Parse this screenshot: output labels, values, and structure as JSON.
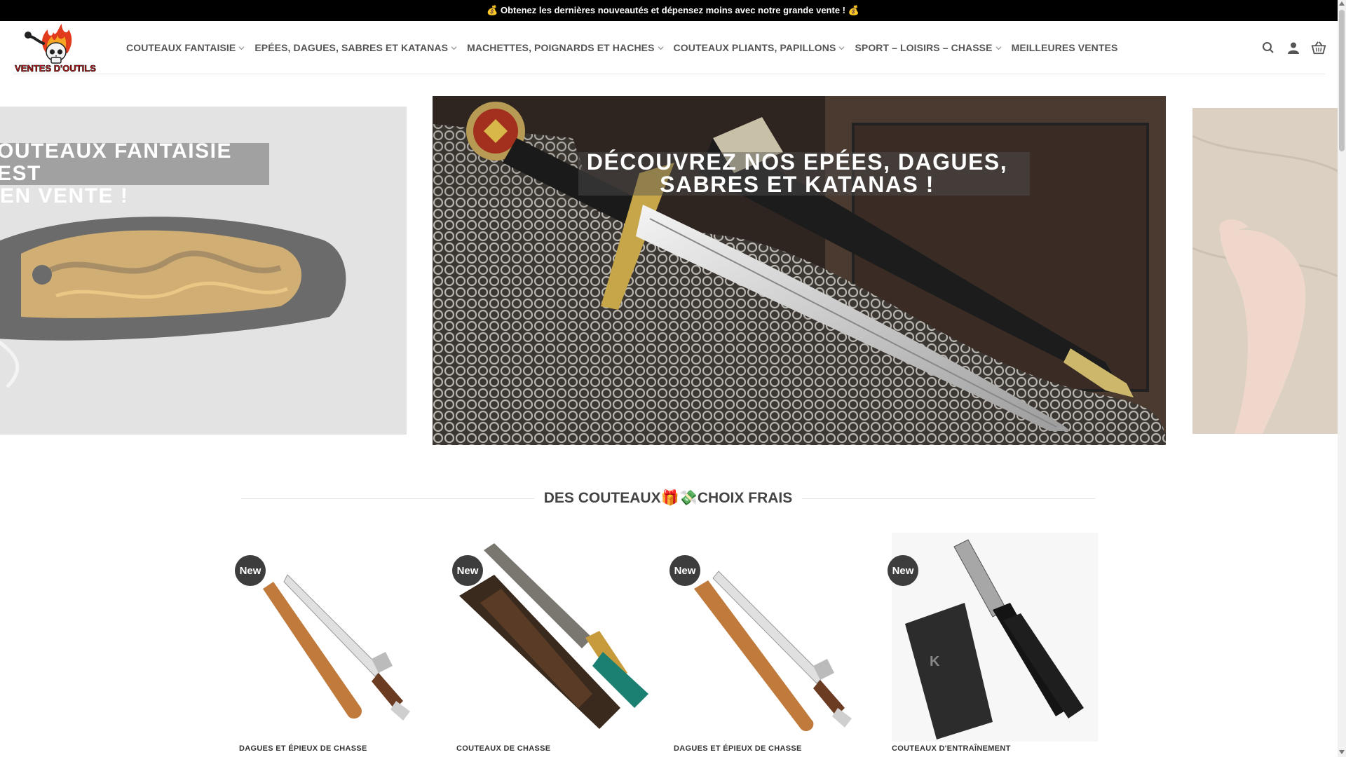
{
  "promo": {
    "text": "💰 Obtenez les dernières nouveautés et dépensez moins avec notre grande vente ! 💰"
  },
  "header": {
    "logo_text": "VENTES D'OUTILS",
    "nav": [
      {
        "label": "COUTEAUX FANTAISIE",
        "has_dropdown": true
      },
      {
        "label": "EPÉES, DAGUES, SABRES ET KATANAS",
        "has_dropdown": true
      },
      {
        "label": "MACHETTES, POIGNARDS ET HACHES",
        "has_dropdown": true
      },
      {
        "label": "COUTEAUX PLIANTS, PAPILLONS",
        "has_dropdown": true
      },
      {
        "label": "SPORT – LOISIRS – CHASSE",
        "has_dropdown": true
      },
      {
        "label": "MEILLEURES VENTES",
        "has_dropdown": false
      }
    ],
    "icons": [
      "search-icon",
      "account-icon",
      "cart-icon"
    ]
  },
  "slider": {
    "left": {
      "line1": "OUTEAUX FANTAISIE EST",
      "line2": "EN VENTE !"
    },
    "main": {
      "line1": "DÉCOUVREZ NOS EPÉES, DAGUES,",
      "line2": "SABRES ET KATANAS !"
    }
  },
  "section": {
    "title": "DES COUTEAUX🎁💸CHOIX FRAIS"
  },
  "products": [
    {
      "badge": "New",
      "category": "DAGUES ET ÉPIEUX DE CHASSE"
    },
    {
      "badge": "New",
      "category": "COUTEAUX DE CHASSE"
    },
    {
      "badge": "New",
      "category": "DAGUES ET ÉPIEUX DE CHASSE"
    },
    {
      "badge": "New",
      "category": "COUTEAUX D'ENTRAÎNEMENT"
    }
  ],
  "colors": {
    "promo_bg": "#000000",
    "nav_text": "#555555",
    "badge_bg": "#3d3d3d",
    "logo_red": "#d11f1f"
  }
}
